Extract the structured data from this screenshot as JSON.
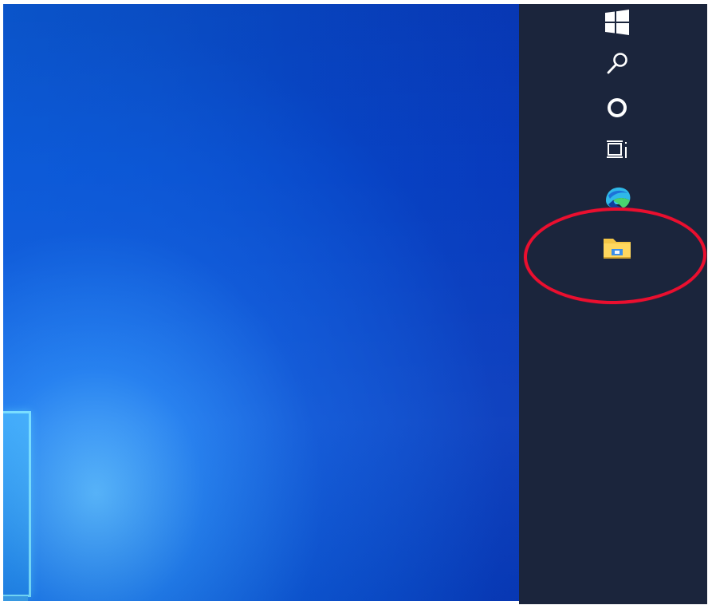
{
  "screen": {
    "taskbar": {
      "items": [
        {
          "name": "start",
          "icon": "windows-logo-icon"
        },
        {
          "name": "search",
          "icon": "search-icon"
        },
        {
          "name": "cortana",
          "icon": "circle-icon"
        },
        {
          "name": "task-view",
          "icon": "task-view-icon"
        },
        {
          "name": "edge",
          "icon": "edge-icon"
        },
        {
          "name": "file-explorer",
          "icon": "folder-icon",
          "highlighted": true
        }
      ]
    },
    "colors": {
      "desktop_blue": "#0a55d0",
      "taskbar": "#1b253c",
      "highlight": "#ea0f2f",
      "explorer_yellow": "#f4c646"
    }
  }
}
